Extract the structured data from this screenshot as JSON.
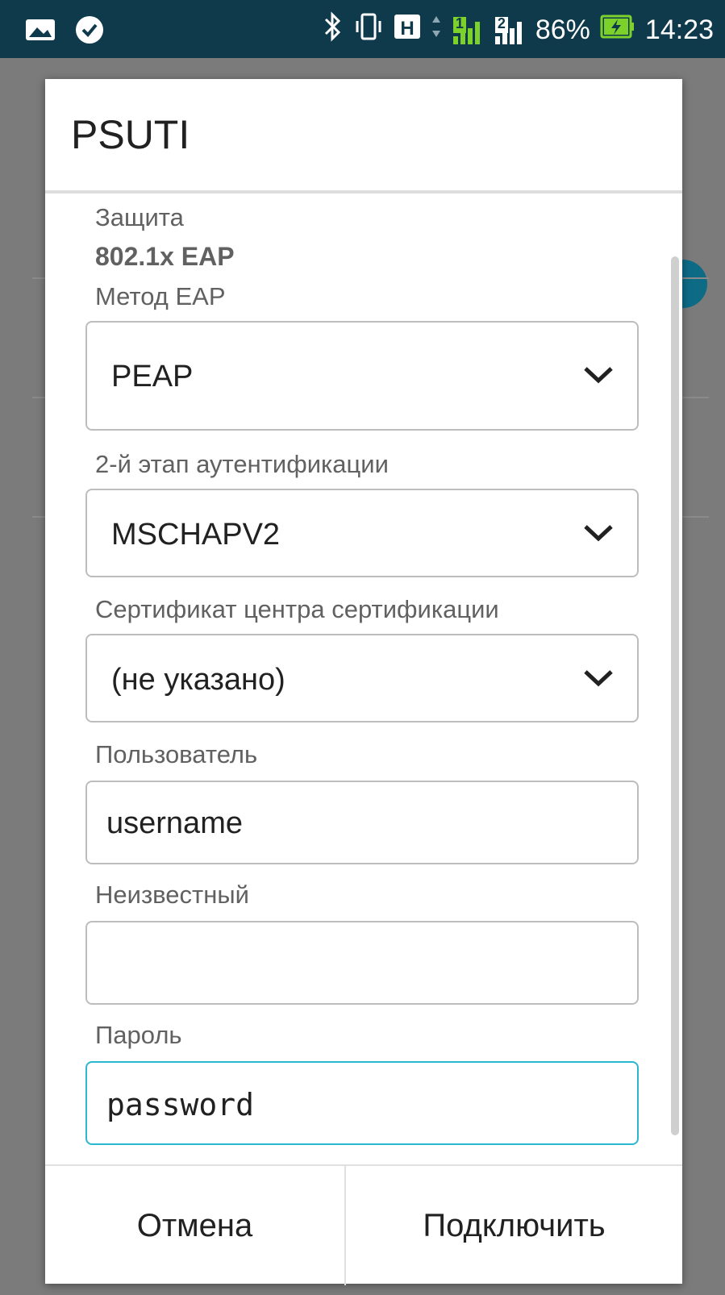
{
  "status_bar": {
    "battery_percent": "86%",
    "time": "14:23",
    "network_type": "H",
    "sim1": "1",
    "sim2": "2",
    "icons": [
      "image-icon",
      "check-circle-icon",
      "bluetooth-icon",
      "vibrate-icon",
      "hspa-icon",
      "sim1-signal-icon",
      "sim2-signal-icon",
      "battery-charging-icon"
    ]
  },
  "dialog": {
    "title": "PSUTI",
    "security_label": "Защита",
    "security_value": "802.1x EAP",
    "eap_method_label": "Метод EAP",
    "eap_method_value": "PEAP",
    "phase2_label": "2-й этап аутентификации",
    "phase2_value": "MSCHAPV2",
    "ca_cert_label": "Сертификат центра сертификации",
    "ca_cert_value": "(не указано)",
    "user_label": "Пользователь",
    "user_value": "username",
    "anonymous_label": "Неизвестный",
    "anonymous_value": "",
    "password_label": "Пароль",
    "password_value": "password",
    "cancel_label": "Отмена",
    "connect_label": "Подключить"
  },
  "colors": {
    "status_bar_bg": "#0e3a4c",
    "accent": "#2bb8d0",
    "battery_green": "#7cd22b"
  }
}
